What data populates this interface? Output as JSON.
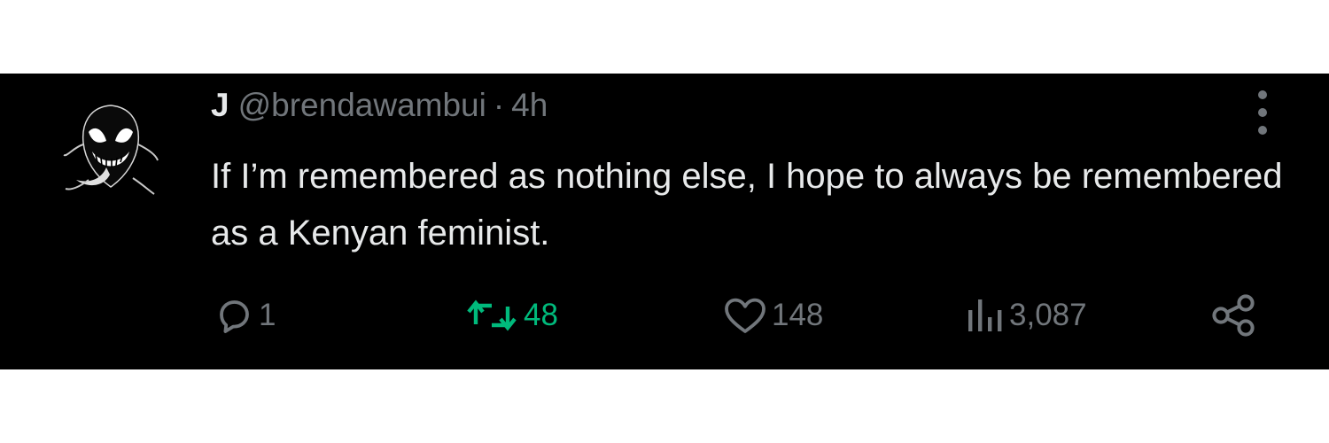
{
  "tweet": {
    "author": {
      "display_name": "J",
      "handle": "@brendawambui",
      "separator": "·",
      "time": "4h",
      "avatar_icon": "venom-face-avatar"
    },
    "text": "If I’m remembered as nothing else, I hope to always be remembered as a Kenyan feminist.",
    "more_icon": "vertical-ellipsis-icon",
    "actions": {
      "reply": {
        "icon": "speech-bubble-icon",
        "count": "1"
      },
      "retweet": {
        "icon": "retweet-arrows-icon",
        "count": "48",
        "active": true,
        "color": "#00ba7c"
      },
      "like": {
        "icon": "heart-icon",
        "count": "148"
      },
      "views": {
        "icon": "bar-chart-icon",
        "count": "3,087"
      },
      "share": {
        "icon": "share-nodes-icon"
      }
    }
  },
  "colors": {
    "background": "#000000",
    "text": "#e7e9ea",
    "muted": "#71767b",
    "retweet_active": "#00ba7c"
  }
}
